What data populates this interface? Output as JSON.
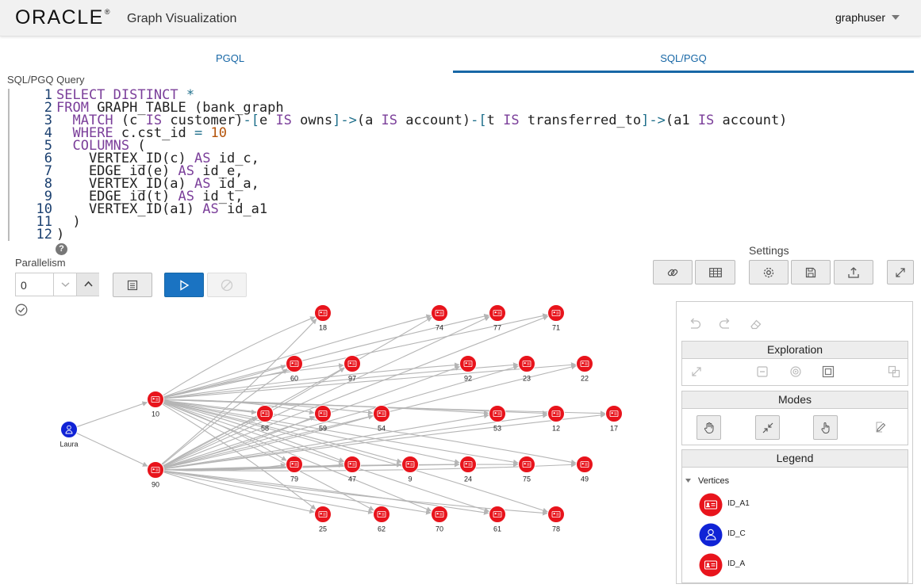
{
  "header": {
    "logo_text": "ORACLE",
    "logo_mark": "®",
    "app_title": "Graph Visualization",
    "user": "graphuser"
  },
  "tabs": [
    {
      "label": "PGQL",
      "active": false
    },
    {
      "label": "SQL/PGQ",
      "active": true
    }
  ],
  "query": {
    "label": "SQL/PGQ Query",
    "lines": [
      "SELECT DISTINCT *",
      "FROM GRAPH_TABLE (bank_graph",
      "  MATCH (c IS customer)-[e IS owns]->(a IS account)-[t IS transferred_to]->(a1 IS account)",
      "  WHERE c.cst_id = 10",
      "  COLUMNS (",
      "    VERTEX_ID(c) AS id_c,",
      "    EDGE_id(e) AS id_e,",
      "    VERTEX_ID(a) AS id_a,",
      "    EDGE_id(t) AS id_t,",
      "    VERTEX_ID(a1) AS id_a1",
      "  )",
      ")"
    ]
  },
  "parallelism": {
    "label": "Parallelism",
    "value": "0"
  },
  "settings": {
    "label": "Settings"
  },
  "panel": {
    "exploration": "Exploration",
    "modes": "Modes",
    "legend": "Legend",
    "legend_group": "Vertices",
    "legend_items": [
      {
        "label": "ID_A1",
        "color": "#e8141c",
        "icon": "id-card-icon"
      },
      {
        "label": "ID_C",
        "color": "#1023d6",
        "icon": "person-icon"
      },
      {
        "label": "ID_A",
        "color": "#e8141c",
        "icon": "id-card-icon"
      }
    ]
  },
  "graph": {
    "vertices": [
      {
        "id": "Laura",
        "type": "ID_C"
      },
      {
        "id": "10",
        "type": "ID_A"
      },
      {
        "id": "90",
        "type": "ID_A"
      },
      {
        "id": "18",
        "type": "ID_A1"
      },
      {
        "id": "74",
        "type": "ID_A1"
      },
      {
        "id": "77",
        "type": "ID_A1"
      },
      {
        "id": "71",
        "type": "ID_A1"
      },
      {
        "id": "60",
        "type": "ID_A1"
      },
      {
        "id": "97",
        "type": "ID_A1"
      },
      {
        "id": "92",
        "type": "ID_A1"
      },
      {
        "id": "23",
        "type": "ID_A1"
      },
      {
        "id": "22",
        "type": "ID_A1"
      },
      {
        "id": "58",
        "type": "ID_A1"
      },
      {
        "id": "59",
        "type": "ID_A1"
      },
      {
        "id": "54",
        "type": "ID_A1"
      },
      {
        "id": "53",
        "type": "ID_A1"
      },
      {
        "id": "12",
        "type": "ID_A1"
      },
      {
        "id": "17",
        "type": "ID_A1"
      },
      {
        "id": "79",
        "type": "ID_A1"
      },
      {
        "id": "47",
        "type": "ID_A1"
      },
      {
        "id": "9",
        "type": "ID_A1"
      },
      {
        "id": "24",
        "type": "ID_A1"
      },
      {
        "id": "75",
        "type": "ID_A1"
      },
      {
        "id": "49",
        "type": "ID_A1"
      },
      {
        "id": "25",
        "type": "ID_A1"
      },
      {
        "id": "62",
        "type": "ID_A1"
      },
      {
        "id": "70",
        "type": "ID_A1"
      },
      {
        "id": "61",
        "type": "ID_A1"
      },
      {
        "id": "78",
        "type": "ID_A1"
      }
    ],
    "colors": {
      "account": "#e8141c",
      "customer": "#1023d6",
      "edge": "#b5b5b5"
    }
  }
}
